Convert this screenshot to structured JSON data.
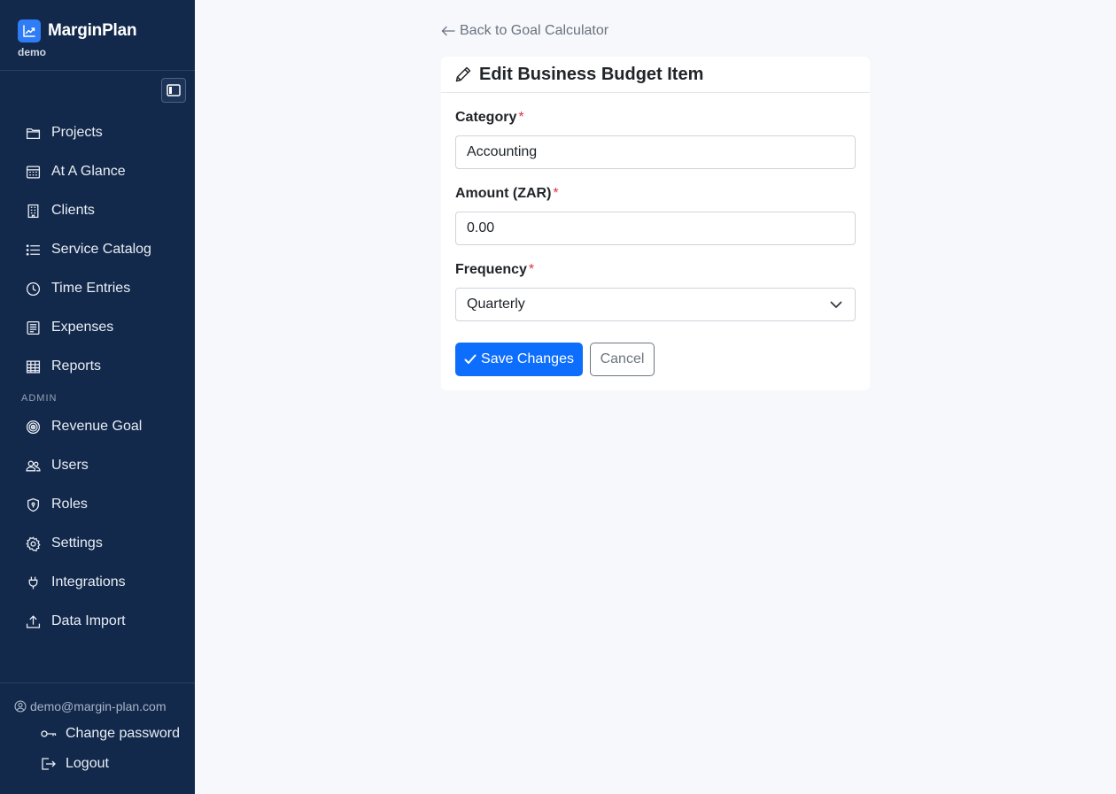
{
  "app": {
    "name": "MarginPlan",
    "tenant": "demo"
  },
  "sidebar": {
    "items": [
      {
        "label": "Projects",
        "icon": "folder-icon"
      },
      {
        "label": "At A Glance",
        "icon": "calendar-grid-icon"
      },
      {
        "label": "Clients",
        "icon": "building-icon"
      },
      {
        "label": "Service Catalog",
        "icon": "list-icon"
      },
      {
        "label": "Time Entries",
        "icon": "clock-icon"
      },
      {
        "label": "Expenses",
        "icon": "receipt-icon"
      },
      {
        "label": "Reports",
        "icon": "table-icon"
      }
    ],
    "admin_label": "ADMIN",
    "admin_items": [
      {
        "label": "Revenue Goal",
        "icon": "target-icon"
      },
      {
        "label": "Users",
        "icon": "users-icon"
      },
      {
        "label": "Roles",
        "icon": "shield-icon"
      },
      {
        "label": "Settings",
        "icon": "gear-icon"
      },
      {
        "label": "Integrations",
        "icon": "plug-icon"
      },
      {
        "label": "Data Import",
        "icon": "upload-icon"
      }
    ],
    "user": {
      "email": "demo@margin-plan.com",
      "change_password": "Change password",
      "logout": "Logout"
    }
  },
  "main": {
    "back_link": "Back to Goal Calculator",
    "card_title": "Edit Business Budget Item",
    "fields": {
      "category_label": "Category",
      "category_value": "Accounting",
      "amount_label": "Amount (ZAR)",
      "amount_value": "0.00",
      "frequency_label": "Frequency",
      "frequency_value": "Quarterly",
      "required_mark": "*"
    },
    "save_label": "Save Changes",
    "cancel_label": "Cancel"
  },
  "colors": {
    "sidebar_bg": "#13294b",
    "brand_accent": "#2f7df6",
    "primary": "#0d6efd",
    "required": "#dc3545",
    "page_bg": "#f6f8fb"
  }
}
